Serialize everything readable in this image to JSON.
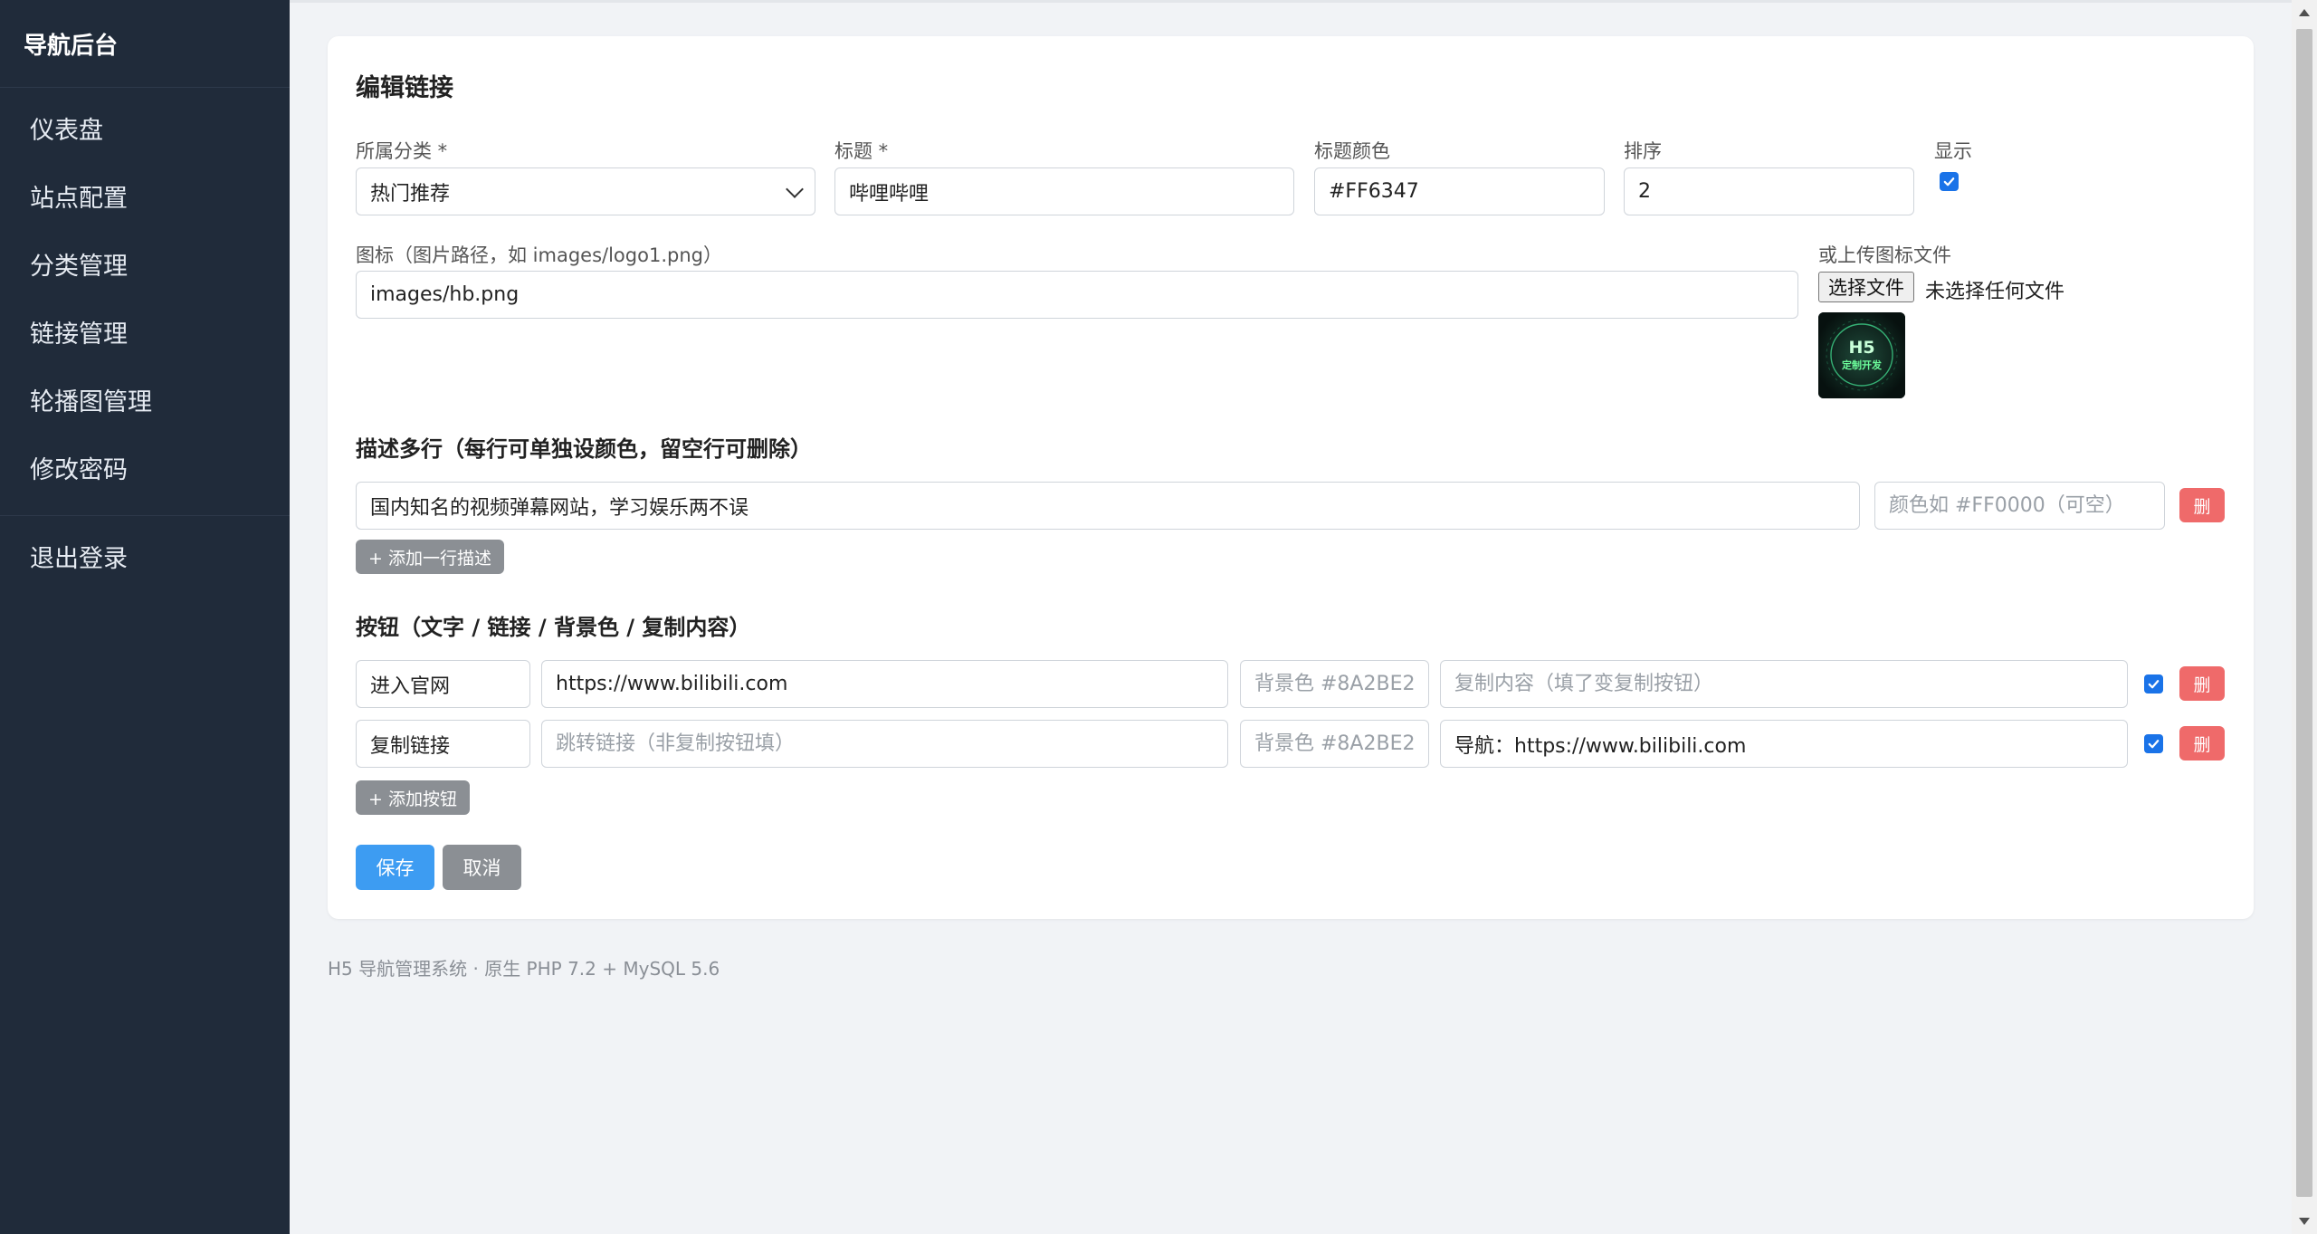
{
  "sidebar": {
    "brand": "导航后台",
    "items": [
      {
        "label": "仪表盘"
      },
      {
        "label": "站点配置"
      },
      {
        "label": "分类管理"
      },
      {
        "label": "链接管理"
      },
      {
        "label": "轮播图管理"
      },
      {
        "label": "修改密码"
      }
    ],
    "logout": "退出登录"
  },
  "form": {
    "title": "编辑链接",
    "category": {
      "label": "所属分类 *",
      "value": "热门推荐"
    },
    "title_field": {
      "label": "标题 *",
      "value": "哔哩哔哩"
    },
    "title_color": {
      "label": "标题颜色",
      "value": "#FF6347"
    },
    "sort": {
      "label": "排序",
      "value": "2"
    },
    "show": {
      "label": "显示",
      "checked": true
    },
    "icon": {
      "label": "图标（图片路径，如 images/logo1.png）",
      "value": "images/hb.png"
    },
    "upload": {
      "label": "或上传图标文件",
      "button": "选择文件",
      "status": "未选择任何文件"
    },
    "preview_icon": {
      "line1": "H5",
      "line2": "定制开发"
    },
    "desc_section": {
      "title": "描述多行（每行可单独设颜色，留空行可删除）",
      "rows": [
        {
          "text": "国内知名的视频弹幕网站，学习娱乐两不误",
          "color_value": "",
          "color_placeholder": "颜色如 #FF0000（可空）",
          "delete_label": "删"
        }
      ],
      "add_label": "+ 添加一行描述"
    },
    "buttons_section": {
      "title": "按钮（文字 / 链接 / 背景色 / 复制内容）",
      "rows": [
        {
          "text": "进入官网",
          "link_value": "https://www.bilibili.com",
          "link_placeholder": "跳转链接（非复制按钮填）",
          "bg_value": "",
          "bg_placeholder": "背景色 #8A2BE2",
          "copy_value": "",
          "copy_placeholder": "复制内容（填了变复制按钮）",
          "enabled": true,
          "delete_label": "删"
        },
        {
          "text": "复制链接",
          "link_value": "",
          "link_placeholder": "跳转链接（非复制按钮填）",
          "bg_value": "",
          "bg_placeholder": "背景色 #8A2BE2",
          "copy_value": "导航：https://www.bilibili.com",
          "copy_placeholder": "复制内容（填了变复制按钮）",
          "enabled": true,
          "delete_label": "删"
        }
      ],
      "add_label": "+ 添加按钮"
    },
    "save_label": "保存",
    "cancel_label": "取消"
  },
  "footer": "H5 导航管理系统 · 原生 PHP 7.2 + MySQL 5.6",
  "colors": {
    "sidebar_bg": "#202b3a",
    "primary": "#3d9cf2",
    "danger": "#ef6a6a",
    "neutral_button": "#8b8f94",
    "checkbox": "#1a73e8"
  }
}
